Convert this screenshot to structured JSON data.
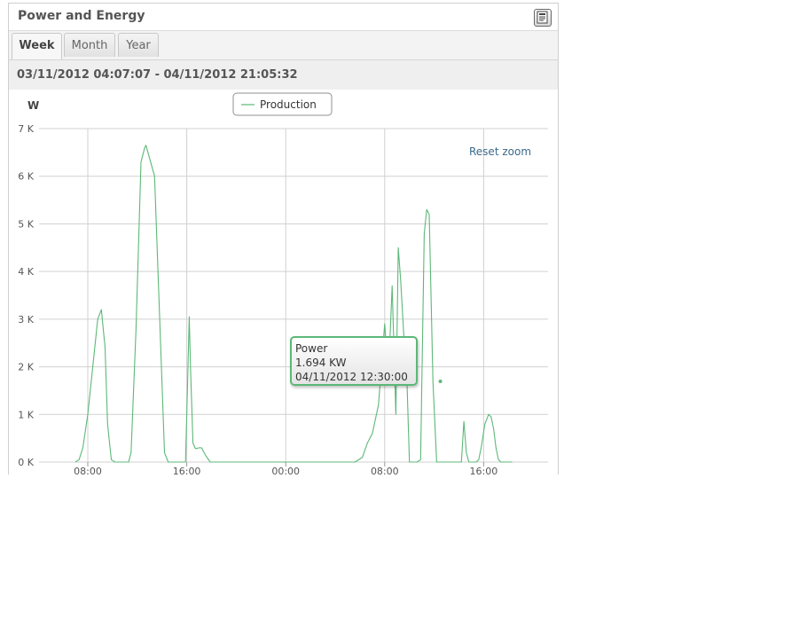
{
  "widget": {
    "title": "Power and Energy",
    "export_icon": "pdf-export-icon"
  },
  "tabs": [
    {
      "label": "Week",
      "active": true
    },
    {
      "label": "Month",
      "active": false
    },
    {
      "label": "Year",
      "active": false
    }
  ],
  "date_range": "03/11/2012 04:07:07 - 04/11/2012 21:05:32",
  "reset_zoom_label": "Reset zoom",
  "colors": {
    "series": "#5cb878",
    "grid": "#d0d0d0",
    "reset_zoom": "#3a6a8a"
  },
  "tooltip": {
    "title": "Power",
    "value": "1.694 KW",
    "time": "04/11/2012 12:30:00"
  },
  "chart_data": {
    "type": "line",
    "ylabel": "W",
    "legend": "top-center",
    "grid": true,
    "yticks": [
      "0 K",
      "1 K",
      "2 K",
      "3 K",
      "4 K",
      "5 K",
      "6 K",
      "7 K"
    ],
    "xticks": [
      "08:00",
      "16:00",
      "00:00",
      "08:00",
      "16:00"
    ],
    "xtick_hours": [
      8,
      16,
      24,
      32,
      40
    ],
    "xlim_hours": [
      4,
      46
    ],
    "ylim": [
      0,
      7000
    ],
    "series": [
      {
        "name": "Production",
        "x_hours": [
          7,
          7.3,
          7.6,
          8.0,
          8.4,
          8.8,
          9.1,
          9.4,
          9.6,
          9.9,
          10.2,
          10.5,
          11.3,
          11.5,
          11.9,
          12.3,
          12.4,
          12.6,
          12.7,
          13.4,
          14.2,
          14.5,
          14.6,
          14.8,
          15.0,
          15.3,
          15.9,
          16.1,
          16.2,
          16.3,
          16.5,
          16.7,
          17.0,
          17.2,
          17.5,
          17.9,
          18.1,
          18.3,
          29.6,
          30.2,
          30.6,
          31.0,
          31.5,
          32.0,
          32.3,
          32.6,
          32.9,
          33.1,
          33.3,
          33.6,
          33.8,
          34.0,
          34.3,
          34.6,
          34.9,
          35.2,
          35.4,
          35.6,
          35.9,
          36.2,
          36.5,
          36.8,
          37.1,
          37.5,
          37.9,
          38.2,
          38.4,
          38.6,
          38.8,
          39.0,
          39.4,
          39.6,
          39.8,
          40.1,
          40.4,
          40.6,
          40.8,
          41.0,
          41.2,
          41.4,
          41.6,
          41.8,
          42.0,
          42.2,
          42.3
        ],
        "y": [
          0,
          50,
          300,
          1000,
          2000,
          3000,
          3200,
          2400,
          800,
          50,
          0,
          0,
          0,
          200,
          2800,
          6300,
          6400,
          6600,
          6650,
          6000,
          200,
          0,
          0,
          0,
          0,
          0,
          0,
          2000,
          3050,
          2000,
          400,
          280,
          300,
          300,
          150,
          0,
          0,
          0,
          0,
          100,
          400,
          600,
          1200,
          2900,
          1800,
          3700,
          1000,
          4500,
          3800,
          2400,
          1700,
          0,
          0,
          0,
          50,
          4800,
          5300,
          5200,
          1700,
          0,
          0,
          0,
          0,
          0,
          0,
          0,
          850,
          200,
          0,
          0,
          0,
          50,
          300,
          800,
          1000,
          950,
          700,
          300,
          50,
          0,
          0,
          0,
          0,
          0,
          0
        ]
      }
    ],
    "highlight_point": {
      "x_hours": 36.5,
      "y": 1694
    }
  }
}
